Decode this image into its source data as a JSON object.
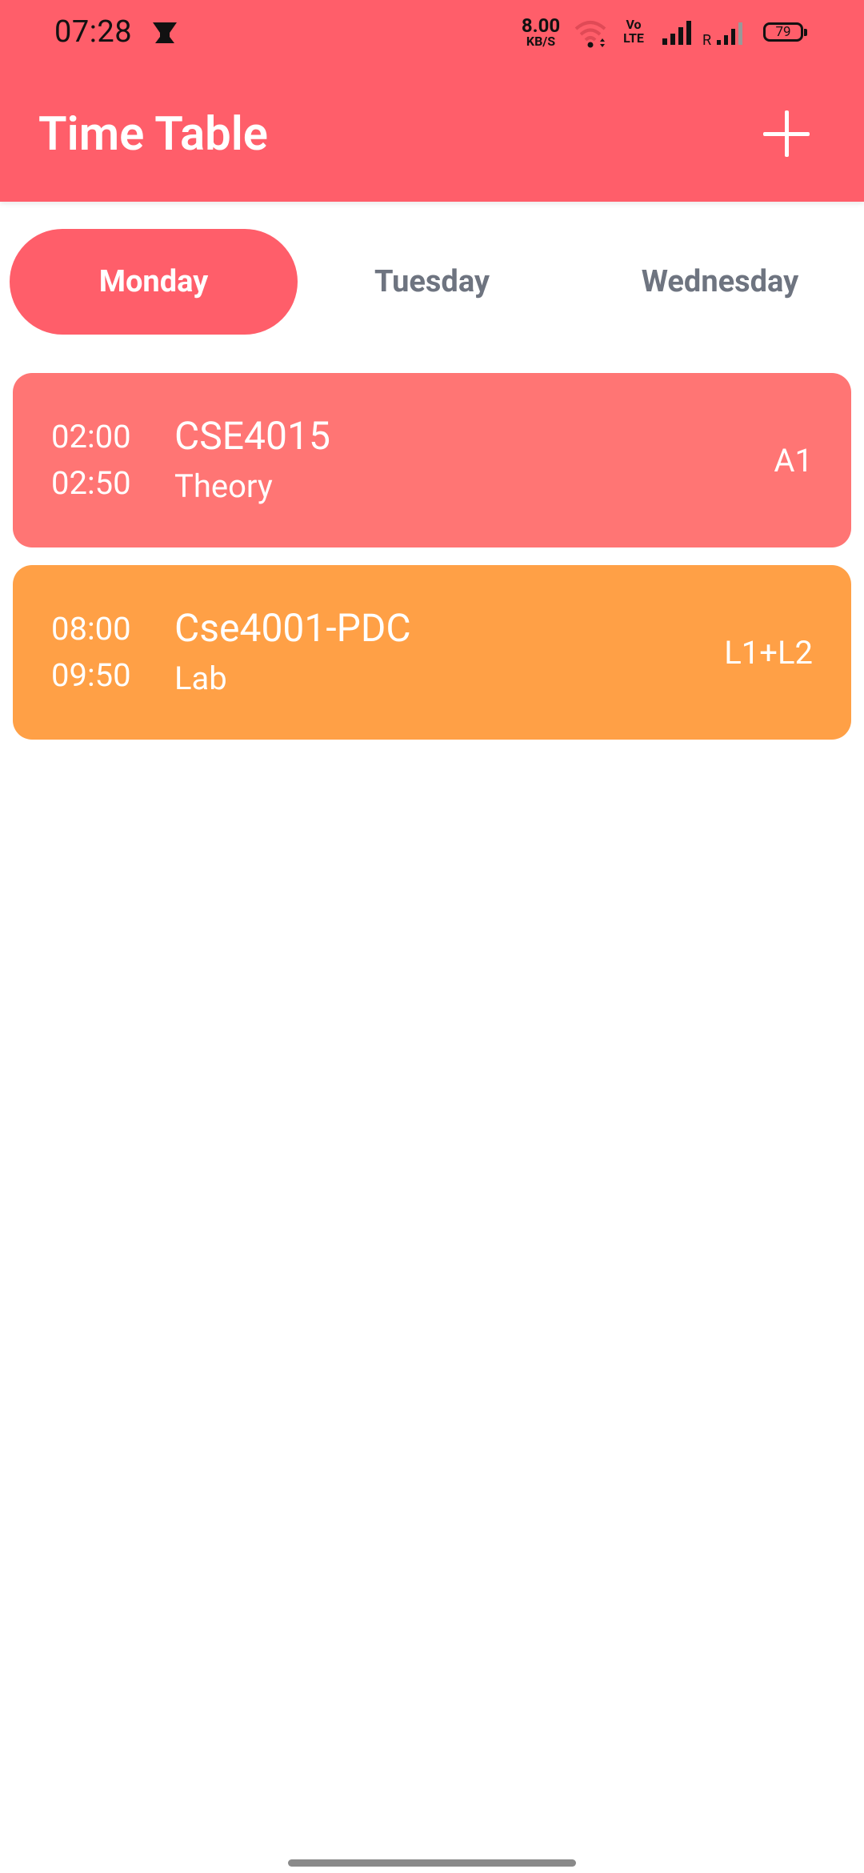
{
  "status_bar": {
    "time": "07:28",
    "net_speed_value": "8.00",
    "net_speed_unit": "KB/S",
    "volte_top": "Vo",
    "volte_bottom": "LTE",
    "roaming": "R",
    "battery": "79"
  },
  "app_bar": {
    "title": "Time Table",
    "add_icon": "plus-icon",
    "color": "#FF5E6A"
  },
  "days": {
    "items": [
      "Monday",
      "Tuesday",
      "Wednesday"
    ],
    "selected": "Monday"
  },
  "classes": [
    {
      "start": "02:00",
      "end": "02:50",
      "course": "CSE4015",
      "type": "Theory",
      "slot": "A1",
      "color": "#FF7574"
    },
    {
      "start": "08:00",
      "end": "09:50",
      "course": "Cse4001-PDC",
      "type": "Lab",
      "slot": "L1+L2",
      "color": "#FFA046"
    }
  ]
}
